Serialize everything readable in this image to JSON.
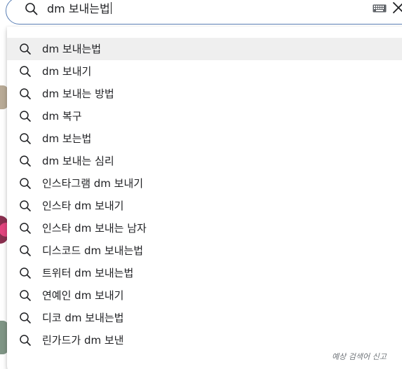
{
  "search": {
    "query": "dm 보내는법",
    "search_icon": "search-icon",
    "keyboard_icon": "keyboard-icon",
    "clear_icon": "close-icon"
  },
  "suggestions": [
    {
      "label": "dm 보내는법",
      "active": true
    },
    {
      "label": "dm 보내기"
    },
    {
      "label": "dm 보내는 방법"
    },
    {
      "label": "dm 복구"
    },
    {
      "label": "dm 보는법"
    },
    {
      "label": "dm 보내는 심리"
    },
    {
      "label": "인스타그램 dm 보내기"
    },
    {
      "label": "인스타 dm 보내기"
    },
    {
      "label": "인스타 dm 보내는 남자"
    },
    {
      "label": "디스코드 dm 보내는법"
    },
    {
      "label": "트위터 dm 보내는법"
    },
    {
      "label": "연예인 dm 보내기"
    },
    {
      "label": "디코 dm 보내는법"
    },
    {
      "label": "린가드가 dm 보낸"
    }
  ],
  "footer": {
    "report_label": "예상 검색어 신고"
  },
  "colors": {
    "search_border": "#5a7fb5",
    "active_row": "#efefef",
    "text": "#202124",
    "muted": "#70757a"
  }
}
